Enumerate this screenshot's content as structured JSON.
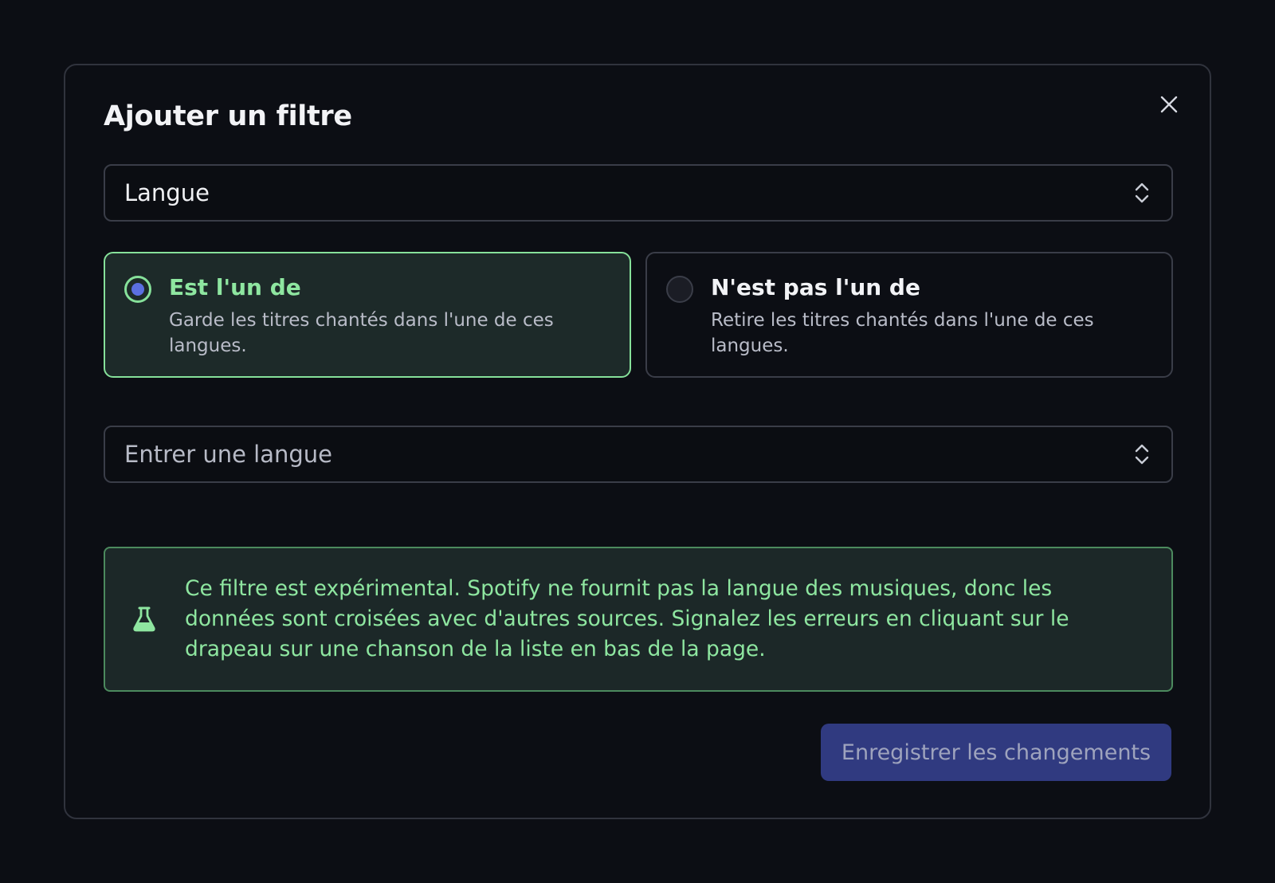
{
  "dialog": {
    "title": "Ajouter un filtre",
    "close_icon": "close-icon"
  },
  "field_select": {
    "value": "Langue",
    "icon": "chevron-up-down-icon"
  },
  "operator_options": [
    {
      "label": "Est l'un de",
      "description": "Garde les titres chantés dans l'une de ces langues.",
      "selected": true
    },
    {
      "label": "N'est pas l'un de",
      "description": "Retire les titres chantés dans l'une de ces langues.",
      "selected": false
    }
  ],
  "language_select": {
    "placeholder": "Entrer une langue",
    "icon": "chevron-up-down-icon"
  },
  "alert": {
    "icon": "flask-icon",
    "text": "Ce filtre est expérimental. Spotify ne fournit pas la langue des musiques, donc les données sont croisées avec d'autres sources. Signalez les erreurs en cliquant sur le drapeau sur une chanson de la liste en bas de la page."
  },
  "footer": {
    "save_label": "Enregistrer les changements"
  },
  "colors": {
    "background": "#0c0e14",
    "accent_green": "#8ee6a0",
    "selected_card_bg": "#1d2a29",
    "primary_button": "#303a80",
    "radio_fill": "#5b6fe0"
  }
}
